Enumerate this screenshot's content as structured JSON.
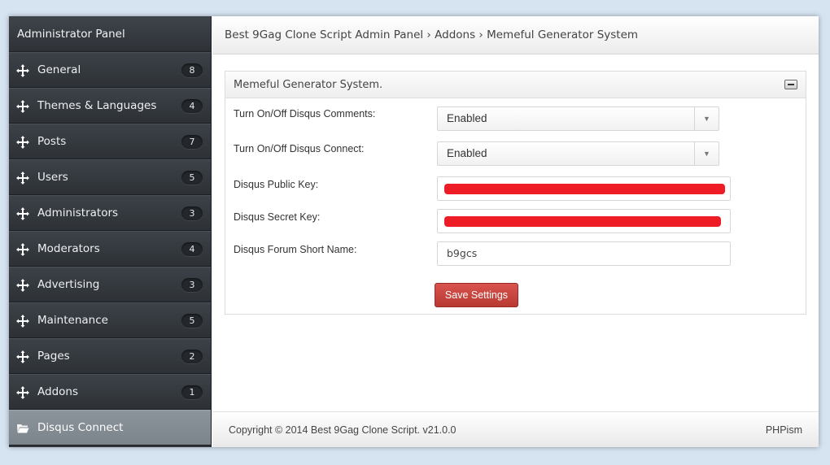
{
  "sidebar": {
    "title": "Administrator Panel",
    "items": [
      {
        "label": "General",
        "count": "8",
        "icon": "move-arrows-icon"
      },
      {
        "label": "Themes & Languages",
        "count": "4",
        "icon": "move-arrows-icon"
      },
      {
        "label": "Posts",
        "count": "7",
        "icon": "move-arrows-icon"
      },
      {
        "label": "Users",
        "count": "5",
        "icon": "move-arrows-icon"
      },
      {
        "label": "Administrators",
        "count": "3",
        "icon": "move-arrows-icon"
      },
      {
        "label": "Moderators",
        "count": "4",
        "icon": "move-arrows-icon"
      },
      {
        "label": "Advertising",
        "count": "3",
        "icon": "move-arrows-icon"
      },
      {
        "label": "Maintenance",
        "count": "5",
        "icon": "move-arrows-icon"
      },
      {
        "label": "Pages",
        "count": "2",
        "icon": "move-arrows-icon"
      },
      {
        "label": "Addons",
        "count": "1",
        "icon": "move-arrows-icon"
      }
    ],
    "active_item": {
      "label": "Disqus Connect",
      "icon": "folder-open-icon"
    }
  },
  "header": {
    "breadcrumb": "Best 9Gag Clone Script Admin Panel › Addons › Memeful Generator System"
  },
  "panel": {
    "title": "Memeful Generator System.",
    "fields": {
      "comments_label": "Turn On/Off Disqus Comments:",
      "comments_value": "Enabled",
      "connect_label": "Turn On/Off Disqus Connect:",
      "connect_value": "Enabled",
      "public_key_label": "Disqus Public Key:",
      "secret_key_label": "Disqus Secret Key:",
      "short_name_label": "Disqus Forum Short Name:",
      "short_name_value": "b9gcs"
    },
    "save_label": "Save Settings"
  },
  "footer": {
    "copyright": "Copyright © 2014 Best 9Gag Clone Script. v21.0.0",
    "brand": "PHPism"
  },
  "colors": {
    "page_bg": "#d6e3f1",
    "sidebar_bg": "#2f3338",
    "active_item_bg": "#8c949c",
    "save_button": "#c9443d",
    "redaction": "#ee1c25"
  }
}
